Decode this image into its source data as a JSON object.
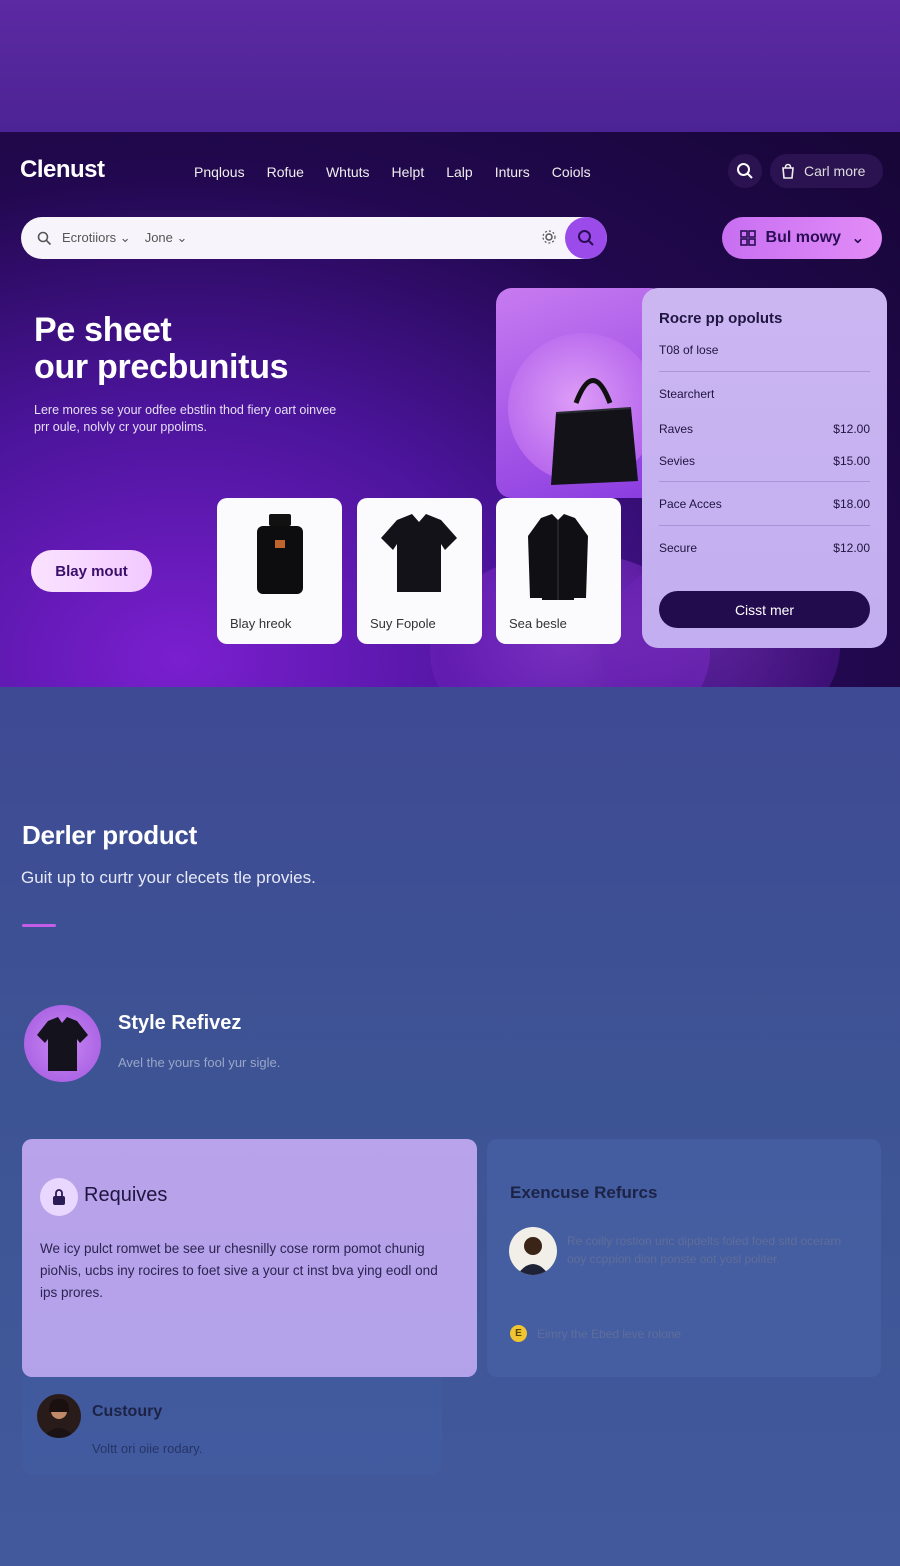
{
  "header": {
    "logo": "Clenust",
    "nav": [
      "Pnqlous",
      "Rofue",
      "Whtuts",
      "Helpt",
      "Lalp",
      "Inturs",
      "Coiols"
    ],
    "cart_label": "Carl more",
    "search": {
      "filter1": "Ecrotiiors",
      "filter2": "Jone"
    },
    "buy_label": "Bul mowy"
  },
  "hero": {
    "title_line1": "Pe sheet",
    "title_line2": "our precbunitus",
    "subtitle": "Lere mores se your odfee ebstlin thod fiery oart oinvee prr oule, nolvly cr your ppolims.",
    "cta_label": "Blay mout",
    "products": [
      {
        "label": "Blay hreok",
        "icon": "perfume-bottle"
      },
      {
        "label": "Suy Fopole",
        "icon": "polo-shirt"
      },
      {
        "label": "Sea besle",
        "icon": "jacket"
      }
    ],
    "bag_icon": "handbag"
  },
  "panel": {
    "title": "Rocre pp opoluts",
    "subtitle": "T08 of lose",
    "section": "Stearchert",
    "rows": [
      {
        "name": "Raves",
        "price": "$12.00"
      },
      {
        "name": "Sevies",
        "price": "$15.00"
      },
      {
        "name": "Pace Acces",
        "price": "$18.00"
      },
      {
        "name": "Secure",
        "price": "$12.00"
      }
    ],
    "checkout_label": "Cisst mer"
  },
  "section": {
    "title": "Derler product",
    "subtitle": "Guit up to curtr your clecets tle provies."
  },
  "style_block": {
    "title": "Style Refivez",
    "subtitle": "Avel the yours fool yur sigle."
  },
  "requires_card": {
    "title": "Requives",
    "body": "We icy pulct romwet be see ur chesnilly cose rorm pomot chunig pioNis, ucbs iny rocires to foet sive a your ct inst bva ying eodl ond ips prores."
  },
  "experience_card": {
    "title": "Exencuse Refurcs",
    "body": "Re coilly rostion uric dipdelts foled foed sitd ocerarn ooy ccppion dion ponste oot yosl politer.",
    "foot": "Eimry the Ebed leve rolone",
    "coin": "E"
  },
  "customer_card": {
    "title": "Custoury",
    "subtitle": "Voltt ori oiie rodary."
  },
  "colors": {
    "accent": "#9a4bea",
    "panel_bg": "#ccb6f2",
    "dark": "#230c4d"
  }
}
